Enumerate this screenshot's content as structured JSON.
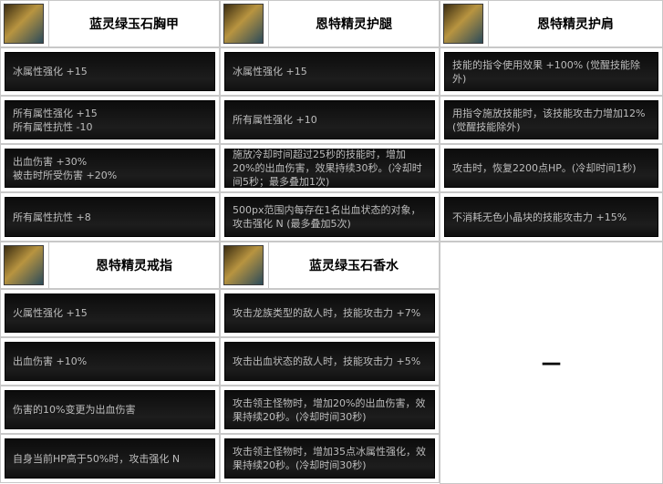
{
  "items": [
    {
      "name": "蓝灵绿玉石胸甲",
      "icon": "chest-armor-icon",
      "effects": [
        [
          "冰属性强化 +15"
        ],
        [
          "所有属性强化 +15",
          "所有属性抗性 -10"
        ],
        [
          "出血伤害 +30%",
          "被击时所受伤害 +20%"
        ],
        [
          "所有属性抗性 +8"
        ]
      ]
    },
    {
      "name": "恩特精灵护腿",
      "icon": "leg-armor-icon",
      "effects": [
        [
          "冰属性强化 +15"
        ],
        [
          "所有属性强化 +10"
        ],
        [
          "施放冷却时间超过25秒的技能时，增加20%的出血伤害，效果持续30秒。(冷却时间5秒；最多叠加1次)"
        ],
        [
          "500px范围内每存在1名出血状态的对象，攻击强化 N (最多叠加5次)"
        ]
      ]
    },
    {
      "name": "恩特精灵护肩",
      "icon": "shoulder-armor-icon",
      "effects": [
        [
          "技能的指令使用效果 +100% (觉醒技能除外)"
        ],
        [
          "用指令施放技能时，该技能攻击力增加12% (觉醒技能除外)"
        ],
        [
          "攻击时，恢复2200点HP。(冷却时间1秒)"
        ],
        [
          "不消耗无色小晶块的技能攻击力 +15%"
        ]
      ]
    },
    {
      "name": "恩特精灵戒指",
      "icon": "ring-icon",
      "effects": [
        [
          "火属性强化 +15"
        ],
        [
          "出血伤害 +10%"
        ],
        [
          "伤害的10%变更为出血伤害"
        ],
        [
          "自身当前HP高于50%时，攻击强化 N"
        ]
      ]
    },
    {
      "name": "蓝灵绿玉石香水",
      "icon": "perfume-bottle-icon",
      "effects": [
        [
          "攻击龙族类型的敌人时，技能攻击力 +7%"
        ],
        [
          "攻击出血状态的敌人时，技能攻击力 +5%"
        ],
        [
          "攻击领主怪物时，增加20%的出血伤害，效果持续20秒。(冷却时间30秒)"
        ],
        [
          "攻击领主怪物时，增加35点冰属性强化，效果持续20秒。(冷却时间30秒)"
        ]
      ]
    }
  ],
  "empty_cell": "—"
}
